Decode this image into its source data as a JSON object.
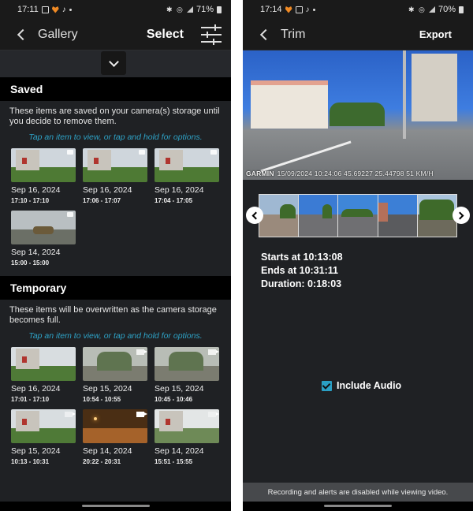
{
  "gallery_screen": {
    "status_bar": {
      "time": "17:11",
      "battery": "71%"
    },
    "app_bar": {
      "back_icon": "chevron-left-icon",
      "title": "Gallery",
      "select_label": "Select",
      "filter_icon": "sliders-icon"
    },
    "collapse_icon": "chevron-down-icon",
    "sections": [
      {
        "title": "Saved",
        "description": "These items are saved on your camera(s) storage until you decide to remove them.",
        "hint": "Tap an item to view, or tap and hold for options.",
        "items": [
          {
            "date": "Sep 16, 2024",
            "time": "17:10 - 17:10",
            "badge": "saved-icon"
          },
          {
            "date": "Sep 16, 2024",
            "time": "17:06 - 17:07",
            "badge": "saved-icon"
          },
          {
            "date": "Sep 16, 2024",
            "time": "17:04 - 17:05",
            "badge": "saved-icon"
          },
          {
            "date": "Sep 14, 2024",
            "time": "15:00 - 15:00",
            "badge": "saved-icon"
          }
        ]
      },
      {
        "title": "Temporary",
        "description": "These items will be overwritten as the camera storage becomes full.",
        "hint": "Tap an item to view, or tap and hold for options.",
        "items": [
          {
            "date": "Sep 16, 2024",
            "time": "17:01 - 17:10",
            "badge": ""
          },
          {
            "date": "Sep 15, 2024",
            "time": "10:54 - 10:55",
            "badge": "video-icon"
          },
          {
            "date": "Sep 15, 2024",
            "time": "10:45 - 10:46",
            "badge": "video-icon"
          },
          {
            "date": "Sep 15, 2024",
            "time": "10:13 - 10:31",
            "badge": "video-icon"
          },
          {
            "date": "Sep 14, 2024",
            "time": "20:22 - 20:31",
            "badge": "video-icon"
          },
          {
            "date": "Sep 14, 2024",
            "time": "15:51 - 15:55",
            "badge": "video-icon"
          }
        ]
      }
    ]
  },
  "trim_screen": {
    "status_bar": {
      "time": "17:14",
      "battery": "70%"
    },
    "app_bar": {
      "back_icon": "chevron-left-icon",
      "title": "Trim",
      "export_label": "Export"
    },
    "video_overlay": {
      "brand": "GARMIN",
      "stamp": "15/09/2024 10:24:06 45.69227 25.44798 51 KM/H"
    },
    "filmstrip": {
      "prev_icon": "chevron-left-icon",
      "next_icon": "chevron-right-icon",
      "frame_count": 5
    },
    "starts_at": "Starts at 10:13:08",
    "ends_at": "Ends at 10:31:11",
    "duration": "Duration: 0:18:03",
    "include_audio": {
      "label": "Include Audio",
      "checked": true
    },
    "notice": "Recording and alerts are disabled while viewing video."
  },
  "colors": {
    "accent": "#2ea3c7",
    "background": "#1f2124",
    "header": "#000000"
  }
}
